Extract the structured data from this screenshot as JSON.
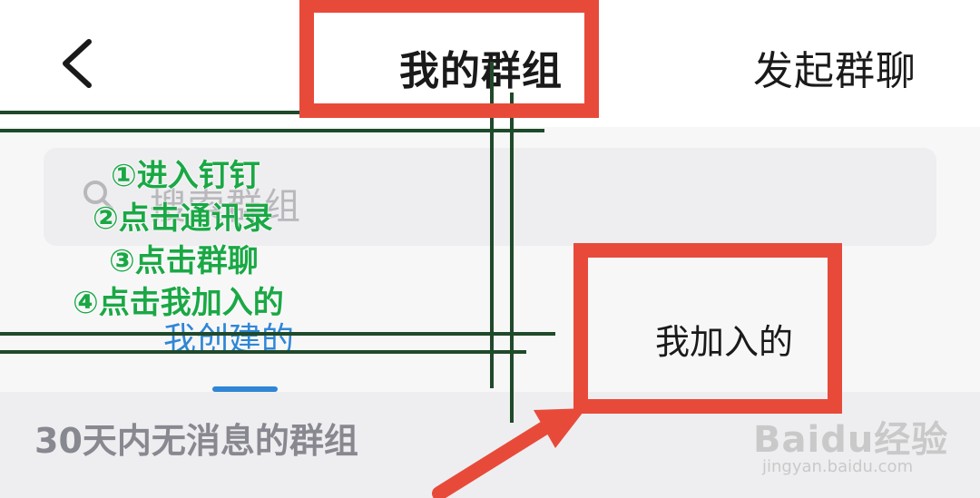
{
  "header": {
    "back_icon": "chevron-left-icon",
    "title": "我的群组",
    "right_action": "发起群聊"
  },
  "search": {
    "icon": "search-icon",
    "placeholder": "搜索群组"
  },
  "tabs": [
    {
      "label": "我创建的",
      "active": true
    },
    {
      "label": "我加入的",
      "active": false
    }
  ],
  "section": {
    "label": "30天内无消息的群组"
  },
  "annotations": {
    "steps": [
      "①进入钉钉",
      "②点击通讯录",
      "③点击群聊",
      "④点击我加入的"
    ],
    "highlight_color": "#e84a3a",
    "line_color": "#1f4a2a",
    "text_color": "#1aa845"
  },
  "watermark": {
    "brand": "Baidu经验",
    "url": "jingyan.baidu.com"
  },
  "colors": {
    "accent": "#2f86d6",
    "background": "#f7f7f8"
  }
}
